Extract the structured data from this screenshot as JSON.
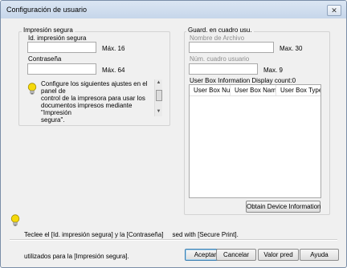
{
  "window": {
    "title": "Configuración de usuario",
    "close_glyph": "✕"
  },
  "secure_print": {
    "group_title": "Impresión segura",
    "id_label": "Id. impresión segura",
    "id_value": "",
    "id_max": "Máx. 16",
    "password_label": "Contraseña",
    "password_value": "",
    "password_max": "Máx. 64",
    "hint_icon": "lightbulb-icon",
    "hint_lines": [
      "Configure los siguientes ajustes en el panel de",
      "control de la impresora para usar los",
      "documentos impresos mediante \"Impresión",
      "segura\"."
    ]
  },
  "user_box": {
    "group_title": "Guard. en cuadro usu.",
    "filename_label": "Nombre de Archivo",
    "filename_value": "",
    "filename_max": "Max. 30",
    "box_number_label": "Núm. cuadro usuario",
    "box_number_value": "",
    "box_number_max": "Max. 9",
    "info_label": "User Box Information  Display count:0",
    "columns": [
      "User Box Nu...",
      "User Box Name",
      "User Box Type"
    ],
    "rows": [],
    "obtain_button": "Obtain Device Information"
  },
  "footer": {
    "hint_icon": "lightbulb-icon",
    "line1": "Teclee el [Id. impresión segura] y la [Contraseña]     sed with [Secure Print].",
    "line2": "utilizados para la [Impresión segura]."
  },
  "buttons": {
    "accept": "Aceptar",
    "cancel": "Cancelar",
    "default_value": "Valor pred",
    "help": "Ayuda"
  },
  "colors": {
    "titlebar": "#c6d6ea",
    "default_button_border": "#3c7fb1",
    "bulb": "#f5d90a"
  }
}
